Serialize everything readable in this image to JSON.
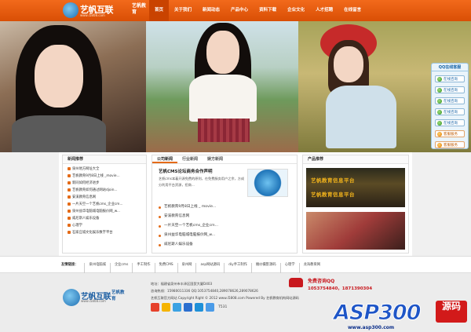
{
  "brand": {
    "name": "艺帆互联",
    "url": "www.i5808.com",
    "side": "艺帆教育"
  },
  "nav": [
    "首页",
    "关于我们",
    "新闻动态",
    "产品中心",
    "资料下载",
    "企业文化",
    "人才招聘",
    "在线留言"
  ],
  "qq": {
    "title": "QQ在线客服",
    "buttons": [
      "在线咨询",
      "在线咨询",
      "在线咨询",
      "在线咨询",
      "在线咨询",
      "客服服务",
      "客服服务"
    ]
  },
  "news": {
    "title": "新闻推荐",
    "items": [
      "泉州地方网址大全",
      "艺帆教育9月8日上线 _movie...",
      "新同如何经济进步",
      "艺帆教育如何通过网站djoin...",
      "安溪教育信息网",
      "一片天空一个艺帆cms_企业cm...",
      "泉州益华电脑城电脑报价网_w...",
      "威尼斯人娱乐设备",
      "心理学",
      "石家庄城文化娱乐数字平台"
    ]
  },
  "tabs": {
    "labels": [
      "公司新闻",
      "行业新闻",
      "娱方新闻"
    ],
    "feature_title": "艺帆CMS论坛商务合作声明",
    "feature_desc": "艺帆cms本着开源免费的原则，在免费服务用户之余，方成分利用平台资源，招商...",
    "items": [
      "艺帆教育9月8日上线 _ movie...",
      "安溪教育信息网",
      "一片天空一个艺帆cms_企业cm...",
      "泉州益华电脑城电脑报价网_w...",
      "威尼斯人娱乐设备"
    ]
  },
  "products": {
    "title": "产品推荐",
    "banner_lines": [
      "艺帆教育信息平台",
      "艺帆教育信息平台"
    ]
  },
  "links": {
    "label": "友情链接：",
    "items": [
      "泉州电脑城",
      "企业cms",
      "手工制作",
      "免费CMS",
      "泉州网",
      "asp网站源码",
      "diy手工制作",
      "婚纱摄影源码",
      "心理学",
      "龙海教育网"
    ]
  },
  "footer": {
    "address": "地址：福建省泉州市丰泽区国贸大厦D403",
    "contact": "咨询热线：15980011336 QQ:1053754840,289078626,289078626",
    "copyright": "艺帆互联官方网站    Copyright Right © 2012 www.i5808.com Powered By 艺帆教育机构网站源码",
    "share_count": "T531"
  },
  "phone": {
    "label": "免费咨询QQ",
    "number": "1053754840，1871390304"
  },
  "watermark": {
    "main": "ASP300",
    "sub": "源码",
    "url": "www.asp300.com"
  },
  "colors": {
    "accent": "#e46b18",
    "header": "#e25d0f",
    "qq_blue": "#1a66a8"
  }
}
